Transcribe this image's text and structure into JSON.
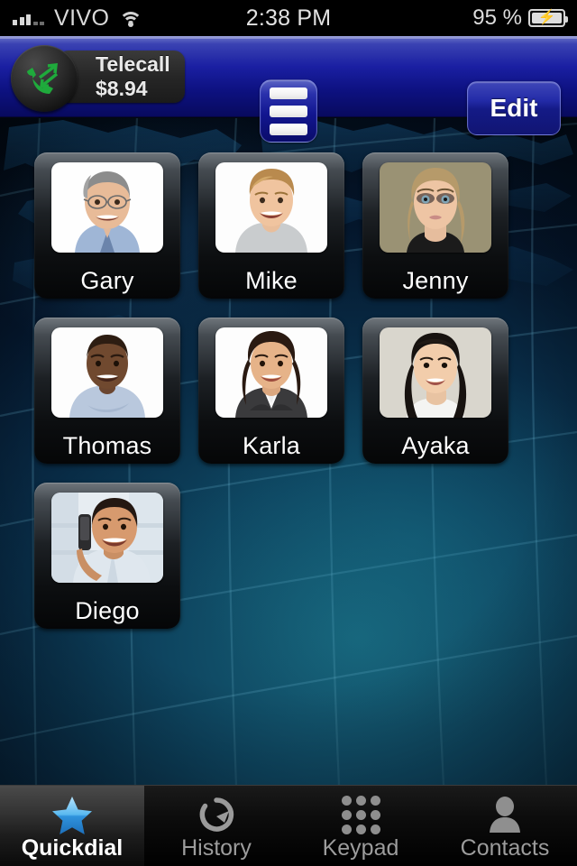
{
  "status_bar": {
    "carrier": "VIVO",
    "signal_icon": "signal-bars-icon",
    "wifi_icon": "wifi-icon",
    "time": "2:38 PM",
    "battery_percent": "95 %",
    "battery_icon": "battery-charging-icon"
  },
  "nav_bar": {
    "logo_icon": "telecall-phone-icon",
    "app_name": "Telecall",
    "balance": "$8.94",
    "menu_icon": "hamburger-menu-icon",
    "edit_label": "Edit",
    "accent_color": "#1a1fa2"
  },
  "quickdial": {
    "rows": [
      [
        {
          "name": "Gary",
          "photo": "portrait-man-glasses-blue-shirt"
        },
        {
          "name": "Mike",
          "photo": "portrait-young-man-gray-tshirt"
        },
        {
          "name": "Jenny",
          "photo": "portrait-blonde-woman-olive-bg"
        }
      ],
      [
        {
          "name": "Thomas",
          "photo": "portrait-man-light-blue-shirt"
        },
        {
          "name": "Karla",
          "photo": "portrait-woman-dark-blazer"
        },
        {
          "name": "Ayaka",
          "photo": "portrait-woman-long-dark-hair"
        }
      ],
      [
        {
          "name": "Diego",
          "photo": "portrait-man-on-phone"
        }
      ]
    ]
  },
  "tab_bar": {
    "active_color": "#3fa9f5",
    "tabs": [
      {
        "label": "Quickdial",
        "icon": "star-icon",
        "active": true
      },
      {
        "label": "History",
        "icon": "refresh-clock-icon",
        "active": false
      },
      {
        "label": "Keypad",
        "icon": "dialpad-icon",
        "active": false
      },
      {
        "label": "Contacts",
        "icon": "person-icon",
        "active": false
      }
    ]
  }
}
